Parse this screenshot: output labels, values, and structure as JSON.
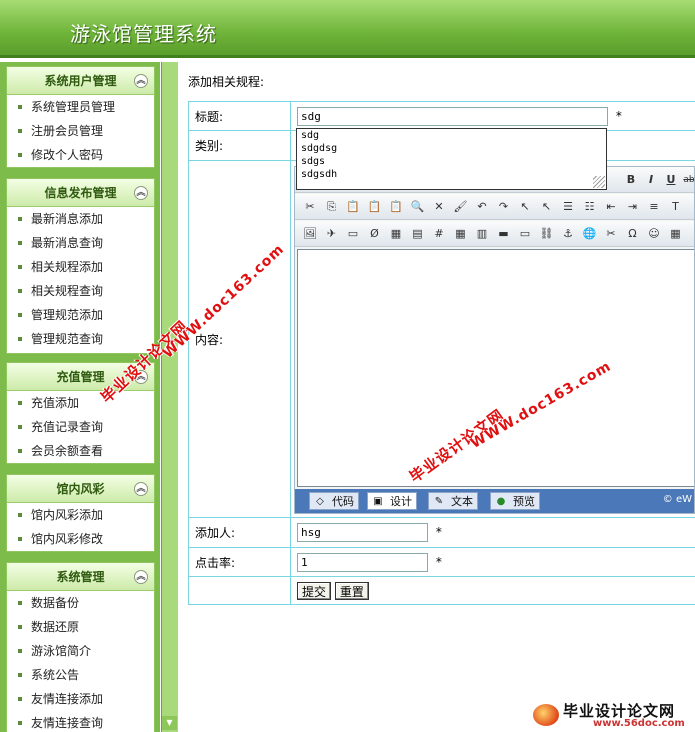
{
  "header": {
    "title": "游泳馆管理系统"
  },
  "sidebar": {
    "groups": [
      {
        "title": "系统用户管理",
        "items": [
          "系统管理员管理",
          "注册会员管理",
          "修改个人密码"
        ]
      },
      {
        "title": "信息发布管理",
        "items": [
          "最新消息添加",
          "最新消息查询",
          "相关规程添加",
          "相关规程查询",
          "管理规范添加",
          "管理规范查询"
        ]
      },
      {
        "title": "充值管理",
        "items": [
          "充值添加",
          "充值记录查询",
          "会员余额查看"
        ]
      },
      {
        "title": "馆内风彩",
        "items": [
          "馆内风彩添加",
          "馆内风彩修改"
        ]
      },
      {
        "title": "系统管理",
        "items": [
          "数据备份",
          "数据还原",
          "游泳馆简介",
          "系统公告",
          "友情连接添加",
          "友情连接查询"
        ]
      }
    ],
    "collapse_glyph": "︽"
  },
  "main": {
    "section_title": "添加相关规程:",
    "form": {
      "title_label": "标题:",
      "title_value": "sdg",
      "category_label": "类别:",
      "content_label": "内容:",
      "adder_label": "添加人:",
      "adder_value": "hsg",
      "clicks_label": "点击率:",
      "clicks_value": "1",
      "required_mark": "*",
      "submit_label": "提交",
      "reset_label": "重置"
    },
    "autocomplete": [
      "sdg",
      "sdgdsg",
      "sdgs",
      "sdgsdh"
    ],
    "editor": {
      "mode_tabs": [
        {
          "label": "代码",
          "icon": "code-icon",
          "glyph": "◇"
        },
        {
          "label": "设计",
          "icon": "design-icon",
          "glyph": "▣"
        },
        {
          "label": "文本",
          "icon": "text-icon",
          "glyph": "✎"
        },
        {
          "label": "预览",
          "icon": "preview-icon",
          "glyph": "●"
        }
      ],
      "copyright": "© eW",
      "toolbar_row1": [
        "B",
        "I",
        "U",
        "ab"
      ],
      "toolbar_row2": [
        "✂",
        "⎘",
        "📋",
        "📋",
        "📋",
        "🔍",
        "✕",
        "🖌",
        "↶",
        "↷",
        "↖",
        "↖",
        "☰",
        "☷",
        "⇤",
        "⇥",
        "≡",
        "T"
      ],
      "toolbar_row3": [
        "🖼",
        "✈",
        "▭",
        "Ø",
        "▦",
        "▤",
        "#",
        "▦",
        "▥",
        "▬",
        "▭",
        "⛓",
        "⚓",
        "🌐",
        "✂",
        "Ω",
        "☺",
        "▦"
      ]
    }
  },
  "watermark": {
    "site_cn": "毕业设计论文网",
    "site_url": "WWW.doc163.com",
    "badge_text": "毕业设计论文网",
    "badge_url": "www.56doc.com"
  },
  "colors": {
    "header": "#6fb43a",
    "sidebar": "#7dbb4a",
    "table_border": "#7ad6e0",
    "watermark": "#e01010"
  }
}
